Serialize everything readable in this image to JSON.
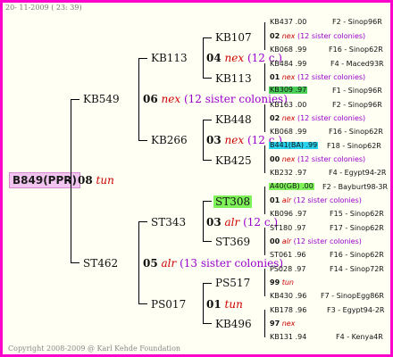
{
  "header": {
    "date": "20- 11-2009 ( 23: 39)"
  },
  "footer": {
    "copyright": "Copyright 2008-2009 @ Karl Kehde Foundation"
  },
  "root": {
    "name": "B849(PPR)",
    "count": "08",
    "code": "tun"
  },
  "gen1": [
    {
      "name": "KB549",
      "count": "06",
      "code": "nex",
      "note": "(12 sister colonies)"
    },
    {
      "name": "ST462",
      "count": "05",
      "code": "alr",
      "note": "(13 sister colonies)"
    }
  ],
  "gen2": [
    {
      "name": "KB113",
      "count": "04",
      "code": "nex",
      "note": "(12 c.)"
    },
    {
      "name": "KB266",
      "count": "03",
      "code": "nex",
      "note": "(12 c.)"
    },
    {
      "name": "ST343",
      "count": "03",
      "code": "alr",
      "note": "(12 c.)"
    },
    {
      "name": "PS017",
      "count": "01",
      "code": "tun",
      "note": ""
    }
  ],
  "gen3": [
    "KB107",
    "KB113",
    "KB448",
    "KB425",
    "ST308",
    "ST369",
    "PS517",
    "KB496"
  ],
  "gen4": [
    {
      "id": "KB437",
      "val": ".00",
      "loc": "F2 - Sinop96R"
    },
    {
      "count": "02",
      "code": "nex",
      "note": "(12 sister colonies)"
    },
    {
      "id": "KB068",
      "val": ".99",
      "loc": "F16 - Sinop62R"
    },
    {
      "id": "KB484",
      "val": ".99",
      "loc": "F4 - Maced93R"
    },
    {
      "count": "01",
      "code": "nex",
      "note": "(12 sister colonies)"
    },
    {
      "id": "KB309",
      "val": ".97",
      "loc": "F1 - Sinop96R"
    },
    {
      "id": "KB163",
      "val": ".00",
      "loc": "F2 - Sinop96R"
    },
    {
      "count": "02",
      "code": "nex",
      "note": "(12 sister colonies)"
    },
    {
      "id": "KB068",
      "val": ".99",
      "loc": "F16 - Sinop62R"
    },
    {
      "id": "B441(BA)",
      "val": ".99",
      "loc": "F18 - Sinop62R"
    },
    {
      "count": "00",
      "code": "nex",
      "note": "(12 sister colonies)"
    },
    {
      "id": "KB232",
      "val": ".97",
      "loc": "F4 - Egypt94-2R"
    },
    {
      "id": "A40(GB)",
      "val": ".00",
      "loc": "F2 - Bayburt98-3R"
    },
    {
      "count": "01",
      "code": "alr",
      "note": "(12 sister colonies)"
    },
    {
      "id": "KB096",
      "val": ".97",
      "loc": "F15 - Sinop62R"
    },
    {
      "id": "ST180",
      "val": ".97",
      "loc": "F17 - Sinop62R"
    },
    {
      "count": "00",
      "code": "alr",
      "note": "(12 sister colonies)"
    },
    {
      "id": "ST061",
      "val": ".96",
      "loc": "F16 - Sinop62R"
    },
    {
      "id": "PS028",
      "val": ".97",
      "loc": "F14 - Sinop72R"
    },
    {
      "count": "99",
      "code": "tun",
      "note": ""
    },
    {
      "id": "KB430",
      "val": ".96",
      "loc": "F7 - SinopEgg86R"
    },
    {
      "id": "KB178",
      "val": ".96",
      "loc": "F3 - Egypt94-2R"
    },
    {
      "count": "97",
      "code": "nex",
      "note": ""
    },
    {
      "id": "KB131",
      "val": ".94",
      "loc": "F4 - Kenya4R"
    }
  ],
  "colors": {
    "border": "#ff00cc",
    "root_bg": "#f2c4f0",
    "code_red": "#cc0000",
    "note_purple": "#9900cc",
    "loc_blue": "#0000cc",
    "hl_green": "#49ce58",
    "hl_cyan": "#29d3f0",
    "hl_lime": "#7ff25a"
  }
}
